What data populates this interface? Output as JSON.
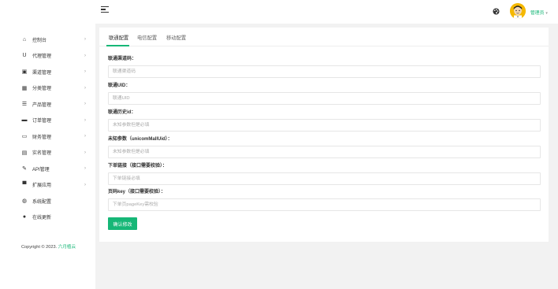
{
  "header": {
    "menu_icon": "hamburger-icon",
    "theme_icon": "palette-icon",
    "user_name": "管理员",
    "user_caret": "▾"
  },
  "sidebar": {
    "items": [
      {
        "label": "控制台",
        "icon": "home-icon",
        "glyph": "⌂"
      },
      {
        "label": "代理管理",
        "icon": "magnet-icon",
        "glyph": "U"
      },
      {
        "label": "渠道管理",
        "icon": "image-icon",
        "glyph": "▣"
      },
      {
        "label": "分类管理",
        "icon": "grid-icon",
        "glyph": "▦"
      },
      {
        "label": "产品管理",
        "icon": "list-icon",
        "glyph": "☰"
      },
      {
        "label": "订单管理",
        "icon": "order-icon",
        "glyph": "▬"
      },
      {
        "label": "财务管理",
        "icon": "card-icon",
        "glyph": "▭"
      },
      {
        "label": "实名管理",
        "icon": "id-card-icon",
        "glyph": "▤"
      },
      {
        "label": "API管理",
        "icon": "wrench-icon",
        "glyph": "✎"
      },
      {
        "label": "扩展应用",
        "icon": "app-icon",
        "glyph": "▀"
      },
      {
        "label": "系统配置",
        "icon": "settings-icon",
        "glyph": "◍"
      },
      {
        "label": "在线更新",
        "icon": "update-icon",
        "glyph": "●"
      }
    ],
    "arrow": "›",
    "copyright_prefix": "Copyright © 2023.",
    "copyright_brand": "六月植云"
  },
  "tabs": [
    {
      "label": "联通配置"
    },
    {
      "label": "电信配置"
    },
    {
      "label": "移动配置"
    }
  ],
  "form": {
    "fields": [
      {
        "label": "联通渠道码：",
        "placeholder": "联通渠道码",
        "value": ""
      },
      {
        "label": "联通UID：",
        "placeholder": "联通UID",
        "value": ""
      },
      {
        "label": "联通历史id：",
        "placeholder": "未知参数但是必填",
        "value": ""
      },
      {
        "label": "未知参数（unicomMallUid）：",
        "placeholder": "未知参数但是必填",
        "value": ""
      },
      {
        "label": "下单链接（接口需要校验）：",
        "placeholder": "下单链接必填",
        "value": ""
      },
      {
        "label": "页码key（接口需要校验）：",
        "placeholder": "下单页pageKey需校验",
        "value": ""
      }
    ],
    "submit_label": "确认修改"
  },
  "colors": {
    "accent": "#16b777",
    "avatar_bg": "#f5b800"
  }
}
